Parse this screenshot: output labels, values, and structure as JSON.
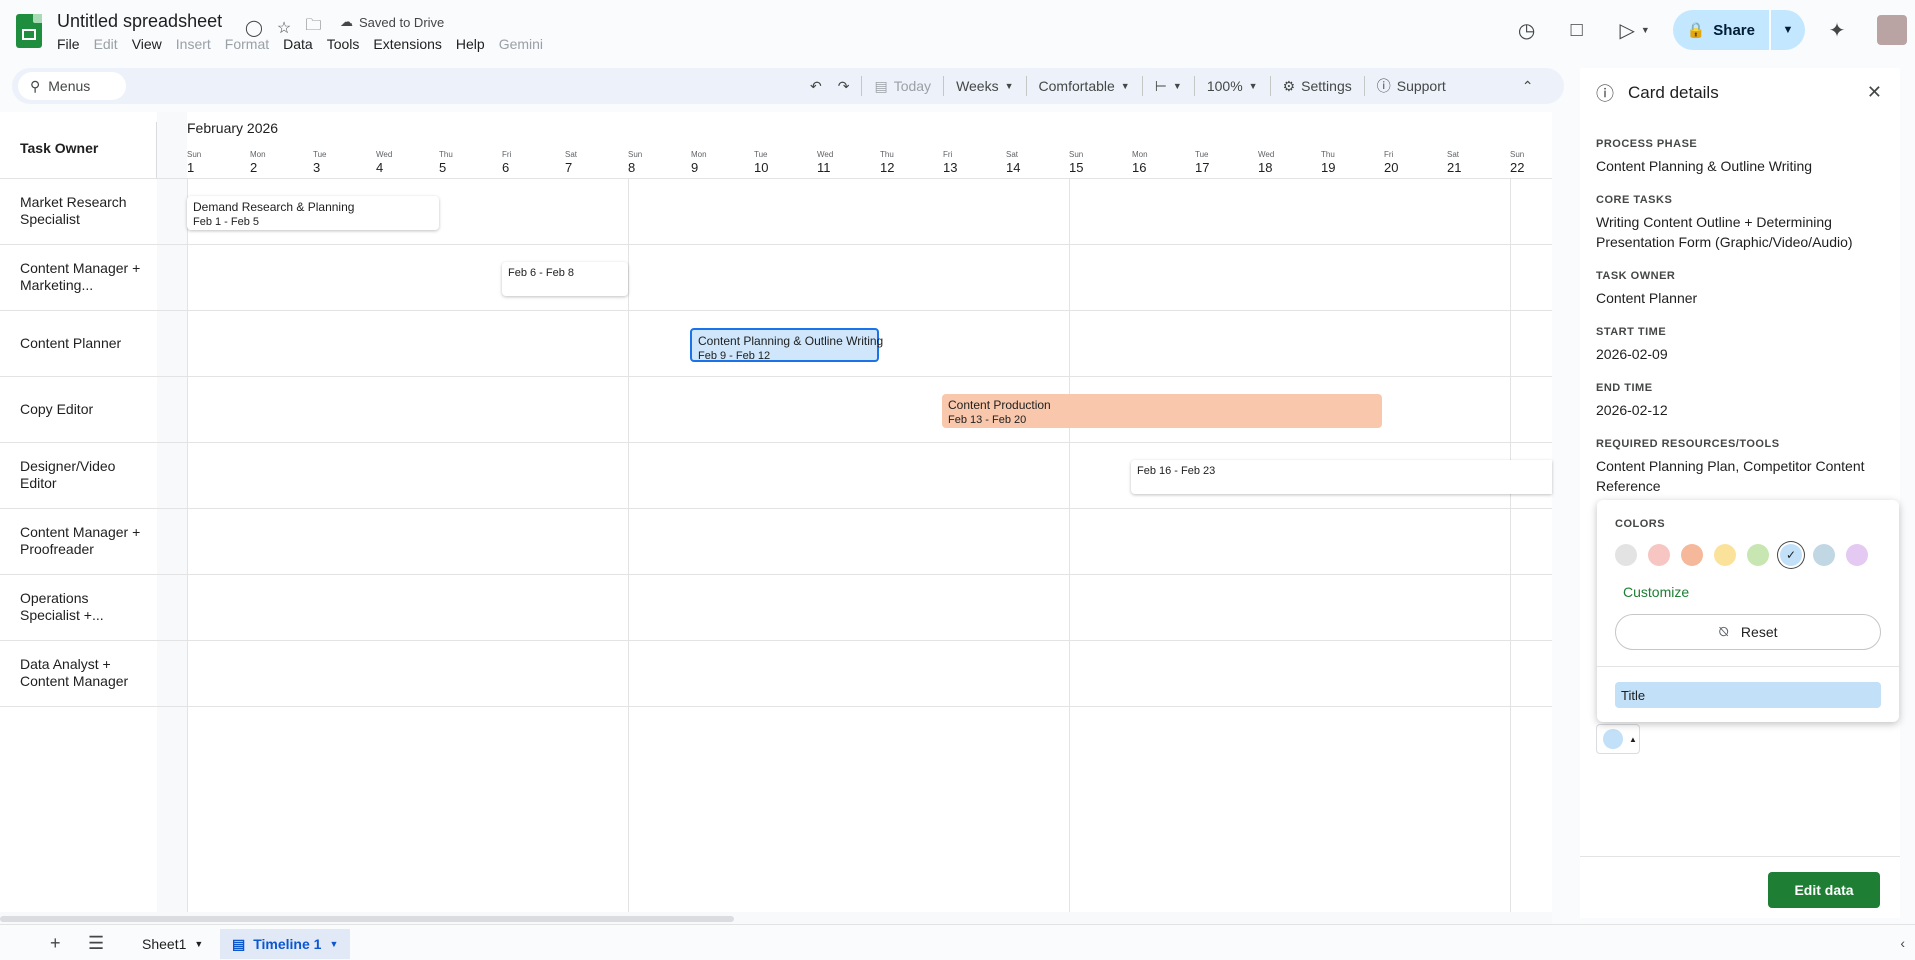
{
  "header": {
    "doc_title": "Untitled spreadsheet",
    "saved_status": "Saved to Drive",
    "menu": [
      "File",
      "Edit",
      "View",
      "Insert",
      "Format",
      "Data",
      "Tools",
      "Extensions",
      "Help",
      "Gemini"
    ],
    "share_label": "Share"
  },
  "toolbar": {
    "menus_label": "Menus",
    "today_label": "Today",
    "weeks_label": "Weeks",
    "density_label": "Comfortable",
    "zoom_label": "100%",
    "settings_label": "Settings",
    "support_label": "Support"
  },
  "timeline": {
    "month": "February 2026",
    "owner_header": "Task Owner",
    "days": [
      {
        "n": "Sun",
        "d": "1"
      },
      {
        "n": "Mon",
        "d": "2"
      },
      {
        "n": "Tue",
        "d": "3"
      },
      {
        "n": "Wed",
        "d": "4"
      },
      {
        "n": "Thu",
        "d": "5"
      },
      {
        "n": "Fri",
        "d": "6"
      },
      {
        "n": "Sat",
        "d": "7"
      },
      {
        "n": "Sun",
        "d": "8"
      },
      {
        "n": "Mon",
        "d": "9"
      },
      {
        "n": "Tue",
        "d": "10"
      },
      {
        "n": "Wed",
        "d": "11"
      },
      {
        "n": "Thu",
        "d": "12"
      },
      {
        "n": "Fri",
        "d": "13"
      },
      {
        "n": "Sat",
        "d": "14"
      },
      {
        "n": "Sun",
        "d": "15"
      },
      {
        "n": "Mon",
        "d": "16"
      },
      {
        "n": "Tue",
        "d": "17"
      },
      {
        "n": "Wed",
        "d": "18"
      },
      {
        "n": "Thu",
        "d": "19"
      },
      {
        "n": "Fri",
        "d": "20"
      },
      {
        "n": "Sat",
        "d": "21"
      },
      {
        "n": "Sun",
        "d": "22"
      }
    ],
    "owners": [
      "Market Research Specialist",
      "Content Manager + Marketing...",
      "Content Planner",
      "Copy Editor",
      "Designer/Video Editor",
      "Content Manager + Proofreader",
      "Operations Specialist +...",
      "Data Analyst + Content Manager"
    ],
    "cards": [
      {
        "title": "Demand Research & Planning",
        "dates": "Feb 1 - Feb 5",
        "style": "white"
      },
      {
        "title": "",
        "dates": "Feb 6 - Feb 8",
        "style": "white"
      },
      {
        "title": "Content Planning & Outline Writing",
        "dates": "Feb 9 - Feb 12",
        "style": "blue"
      },
      {
        "title": "Content Production",
        "dates": "Feb 13 - Feb 20",
        "style": "orange"
      },
      {
        "title": "",
        "dates": "Feb 16 - Feb 23",
        "style": "white"
      }
    ]
  },
  "sheets": {
    "tabs": [
      "Sheet1",
      "Timeline 1"
    ]
  },
  "panel": {
    "title": "Card details",
    "fields": [
      {
        "label": "PROCESS PHASE",
        "value": "Content Planning & Outline Writing"
      },
      {
        "label": "CORE TASKS",
        "value": "Writing Content Outline + Determining Presentation Form (Graphic/Video/Audio)"
      },
      {
        "label": "TASK OWNER",
        "value": "Content Planner"
      },
      {
        "label": "START TIME",
        "value": "2026-02-09"
      },
      {
        "label": "END TIME",
        "value": "2026-02-12"
      },
      {
        "label": "REQUIRED RESOURCES/TOOLS",
        "value": "Content Planning Plan, Competitor Content Reference"
      }
    ],
    "edit_label": "Edit data"
  },
  "color_popup": {
    "label": "COLORS",
    "swatches": [
      "#e3e3e3",
      "#f7c6c2",
      "#f6b89a",
      "#fbe29a",
      "#c7e6b1",
      "#c2e0f8",
      "#c1d7e3",
      "#e4c9f2"
    ],
    "selected_index": 5,
    "customize_label": "Customize",
    "reset_label": "Reset",
    "title_chip": "Title"
  }
}
